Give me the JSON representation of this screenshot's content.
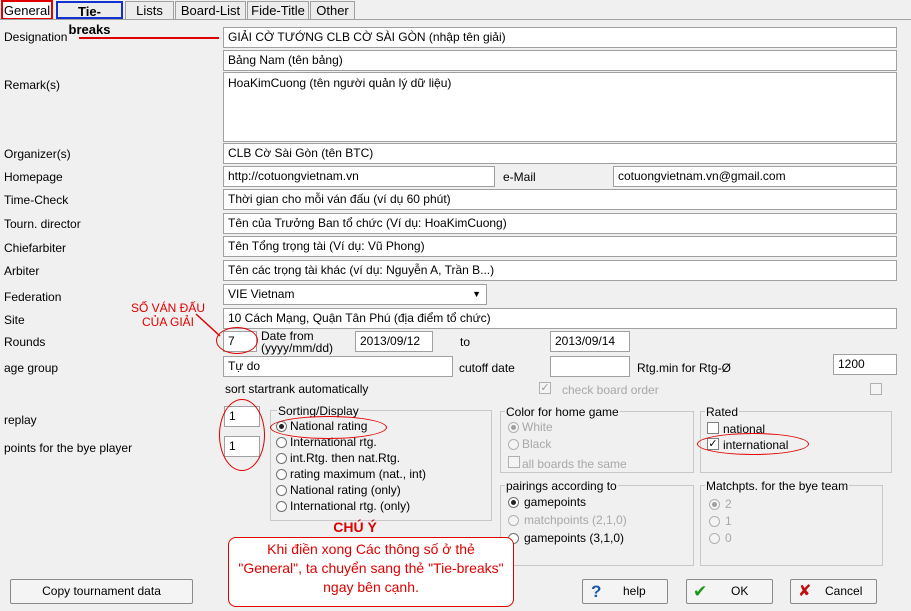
{
  "tabs": [
    "General",
    "Tie-breaks",
    "Lists",
    "Board-List",
    "Fide-Title",
    "Other"
  ],
  "labels": {
    "designation": "Designation",
    "remarks": "Remark(s)",
    "organizer": "Organizer(s)",
    "homepage": "Homepage",
    "email": "e-Mail",
    "time_check": "Time-Check",
    "tourn_director": "Tourn. director",
    "chiefarbiter": "Chiefarbiter",
    "arbiter": "Arbiter",
    "federation": "Federation",
    "site": "Site",
    "rounds": "Rounds",
    "date_from": "Date from",
    "date_format": "(yyyy/mm/dd)",
    "to": "to",
    "age_group": "age group",
    "cutoff_date": "cutoff date",
    "rtg_min": "Rtg.min for Rtg-Ø",
    "sort_startrank": "sort startrank automatically",
    "check_board_order": "check board order",
    "replay": "replay",
    "points_bye": "points for the bye player"
  },
  "fields": {
    "designation": "GIẢI CỜ TƯỚNG CLB CỜ SÀI GÒN (nhập tên giải)",
    "designation2": "Bảng Nam (tên bảng)",
    "remarks": "HoaKimCuong (tên người quản lý dữ liệu)",
    "organizer": "CLB Cờ Sài Gòn (tên BTC)",
    "homepage": "http://cotuongvietnam.vn",
    "email": "cotuongvietnam.vn@gmail.com",
    "time_check": "Thời gian cho mỗi ván đấu (ví dụ 60 phút)",
    "tourn_director": "Tên của Trưởng Ban tổ chức (Ví dụ: HoaKimCuong)",
    "chiefarbiter": "Tên Tổng trọng tài (Ví dụ: Vũ Phong)",
    "arbiter": "Tên các trọng tài khác (ví dụ: Nguyễn A, Trần B...)",
    "federation": "VIE Vietnam",
    "site": "10 Cách Mạng, Quận Tân Phú (địa điểm tổ chức)",
    "rounds": "7",
    "date_from": "2013/09/12",
    "date_to": "2013/09/14",
    "age_group": "Tự do",
    "cutoff_date": "",
    "rtg_min": "1200",
    "replay": "1",
    "points_bye": "1"
  },
  "sorting": {
    "title": "Sorting/Display",
    "options": [
      "National rating",
      "International rtg.",
      "int.Rtg. then nat.Rtg.",
      "rating maximum (nat., int)",
      "National rating (only)",
      "International rtg. (only)"
    ]
  },
  "color_home": {
    "title": "Color for home game",
    "options": [
      "White",
      "Black"
    ],
    "all_boards": "all boards the same"
  },
  "pairings": {
    "title": "pairings according to",
    "options": [
      "gamepoints",
      "matchpoints (2,1,0)",
      "gamepoints (3,1,0)"
    ]
  },
  "rated": {
    "title": "Rated",
    "options": [
      "national",
      "international"
    ]
  },
  "matchpts": {
    "title": "Matchpts. for the bye team",
    "options": [
      "2",
      "1",
      "0"
    ]
  },
  "buttons": {
    "copy": "Copy tournament data",
    "help": "help",
    "help_icon": "?",
    "ok": "OK",
    "ok_icon": "✔",
    "cancel": "Cancel",
    "cancel_icon": "✘"
  },
  "annotations": {
    "rounds_note": "SỐ VÁN ĐẤU CỦA GIẢI",
    "note_title": "CHÚ Ý",
    "note_body": "Khi điền xong Các thông số ở thẻ \"General\", ta chuyển sang thẻ \"Tie-breaks\" ngay bên cạnh."
  },
  "colors": {
    "annotation_red": "#e00000",
    "tab_blue": "#1030d0",
    "ok_green": "#1a9a1a",
    "help_blue": "#1a5aa8",
    "cancel_red": "#c01010"
  }
}
